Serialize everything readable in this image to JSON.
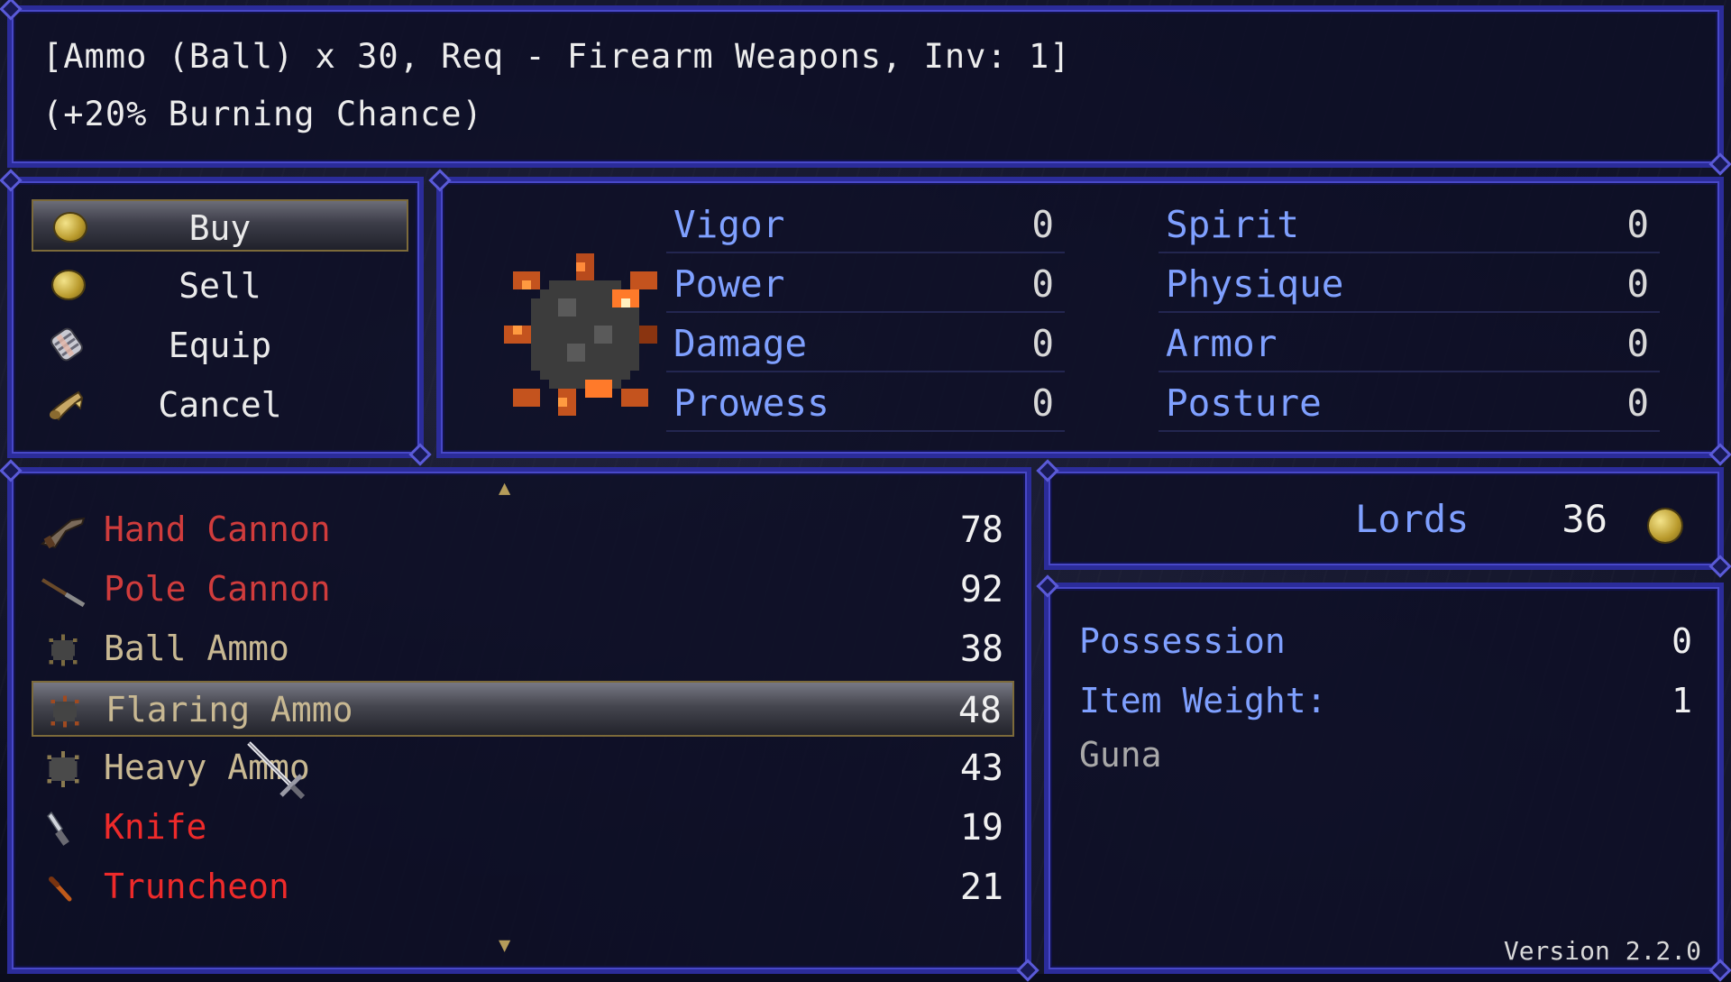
{
  "help": {
    "line1": "[Ammo (Ball) x 30, Req - Firearm Weapons, Inv: 1]",
    "line2": "(+20% Burning Chance)"
  },
  "commands": [
    {
      "label": "Buy",
      "icon": "coin-icon",
      "selected": true
    },
    {
      "label": "Sell",
      "icon": "coin-icon",
      "selected": false
    },
    {
      "label": "Equip",
      "icon": "armor-icon",
      "selected": false
    },
    {
      "label": "Cancel",
      "icon": "horn-icon",
      "selected": false
    }
  ],
  "status": {
    "icon": "spiked-ball-ammo-icon",
    "left": [
      {
        "name": "Vigor",
        "value": "0"
      },
      {
        "name": "Power",
        "value": "0"
      },
      {
        "name": "Damage",
        "value": "0"
      },
      {
        "name": "Prowess",
        "value": "0"
      }
    ],
    "right": [
      {
        "name": "Spirit",
        "value": "0"
      },
      {
        "name": "Physique",
        "value": "0"
      },
      {
        "name": "Armor",
        "value": "0"
      },
      {
        "name": "Posture",
        "value": "0"
      }
    ]
  },
  "items": [
    {
      "name": "Hand Cannon",
      "price": "78",
      "color": "#d03c3c",
      "icon": "hand-cannon-icon"
    },
    {
      "name": "Pole Cannon",
      "price": "92",
      "color": "#d03c3c",
      "icon": "pole-cannon-icon"
    },
    {
      "name": "Ball Ammo",
      "price": "38",
      "color": "#c8b892",
      "icon": "ball-ammo-icon"
    },
    {
      "name": "Flaring Ammo",
      "price": "48",
      "color": "#c8b892",
      "icon": "flaring-ammo-icon",
      "selected": true
    },
    {
      "name": "Heavy Ammo",
      "price": "43",
      "color": "#c8b892",
      "icon": "heavy-ammo-icon"
    },
    {
      "name": "Knife",
      "price": "19",
      "color": "#ee2a2a",
      "icon": "knife-icon"
    },
    {
      "name": "Truncheon",
      "price": "21",
      "color": "#ee2a2a",
      "icon": "truncheon-icon"
    }
  ],
  "gold": {
    "unit": "Lords",
    "amount": "36",
    "icon": "coin-icon"
  },
  "info": {
    "possession_label": "Possession",
    "possession_value": "0",
    "weight_label": "Item Weight:",
    "weight_value": "1",
    "category": "Guna"
  },
  "version": "Version 2.2.0"
}
